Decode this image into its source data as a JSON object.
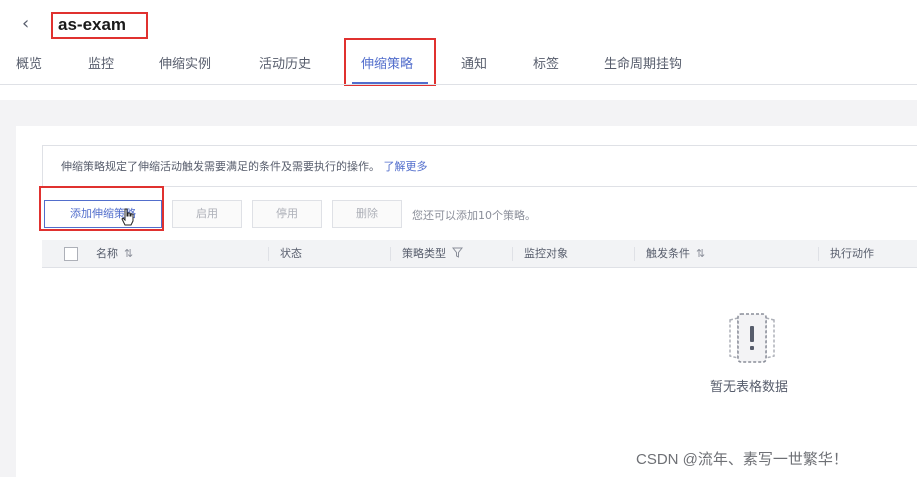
{
  "header": {
    "back_icon": "chevron-left-icon",
    "title": "as-exam"
  },
  "tabs": [
    {
      "label": "概览"
    },
    {
      "label": "监控"
    },
    {
      "label": "伸缩实例"
    },
    {
      "label": "活动历史"
    },
    {
      "label": "伸缩策略",
      "active": true
    },
    {
      "label": "通知"
    },
    {
      "label": "标签"
    },
    {
      "label": "生命周期挂钩"
    }
  ],
  "info": {
    "text": "伸缩策略规定了伸缩活动触发需要满足的条件及需要执行的操作。",
    "link": "了解更多"
  },
  "toolbar": {
    "add_label": "添加伸缩策略",
    "enable_label": "启用",
    "disable_label": "停用",
    "delete_label": "删除",
    "quota_text": "您还可以添加10个策略。"
  },
  "table": {
    "columns": [
      "名称",
      "状态",
      "策略类型",
      "监控对象",
      "触发条件",
      "执行动作"
    ],
    "empty_text": "暂无表格数据"
  },
  "watermark": "CSDN @流年、素写一世繁华！",
  "colors": {
    "accent": "#526ecc",
    "highlight_box": "#e0312f"
  }
}
